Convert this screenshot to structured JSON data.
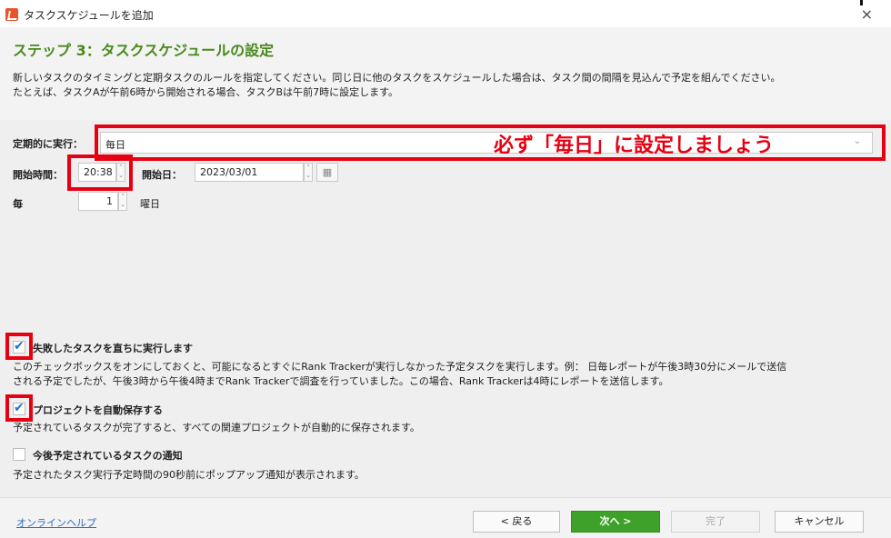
{
  "window": {
    "title": "タスクスケジュールを追加",
    "close_label": "×"
  },
  "header": {
    "step_title": "ステップ 3：タスクスケジュールの設定",
    "description_line1": "新しいタスクのタイミングと定期タスクのルールを指定してください。同じ日に他のタスクをスケジュールした場合は、タスク間の間隔を見込んで予定を組んでください。",
    "description_line2": "たとえば、タスクAが午前6時から開始される場合、タスクBは午前7時に設定します。"
  },
  "form": {
    "repeat_label": "定期的に実行：",
    "repeat_value": "毎日",
    "start_time_label": "開始時間：",
    "start_time_value": "20:38",
    "start_date_label": "開始日：",
    "start_date_value": "2023/03/01",
    "every_label": "毎",
    "every_value": "1",
    "every_unit": "曜日"
  },
  "annotation": {
    "text": "必ず「毎日」に設定しましょう",
    "color": "#e60012"
  },
  "options": [
    {
      "label": "失敗したタスクを直ちに実行します",
      "checked": true,
      "desc1": "このチェックボックスをオンにしておくと、可能になるとすぐにRank Trackerが実行しなかった予定タスクを実行します。例： 日毎レポートが午後3時30分にメールで送信",
      "desc2": "される予定でしたが、午後3時から午後4時までRank Trackerで調査を行っていました。この場合、Rank Trackerは4時にレポートを送信します。"
    },
    {
      "label": "プロジェクトを自動保存する",
      "checked": true,
      "desc1": "予定されているタスクが完了すると、すべての関連プロジェクトが自動的に保存されます。"
    },
    {
      "label": "今後予定されているタスクの通知",
      "checked": false,
      "desc1": "予定されたタスク実行予定時間の90秒前にポップアップ通知が表示されます。"
    }
  ],
  "footer": {
    "help_link": "オンラインヘルプ",
    "back_label": "< 戻る",
    "next_label": "次へ >",
    "finish_label": "完了",
    "cancel_label": "キャンセル"
  },
  "colors": {
    "accent_green": "#3ea22a",
    "title_green": "#4a8a1e",
    "highlight_red": "#e60012",
    "link_blue": "#2e6fbd",
    "check_blue": "#2470c8"
  }
}
